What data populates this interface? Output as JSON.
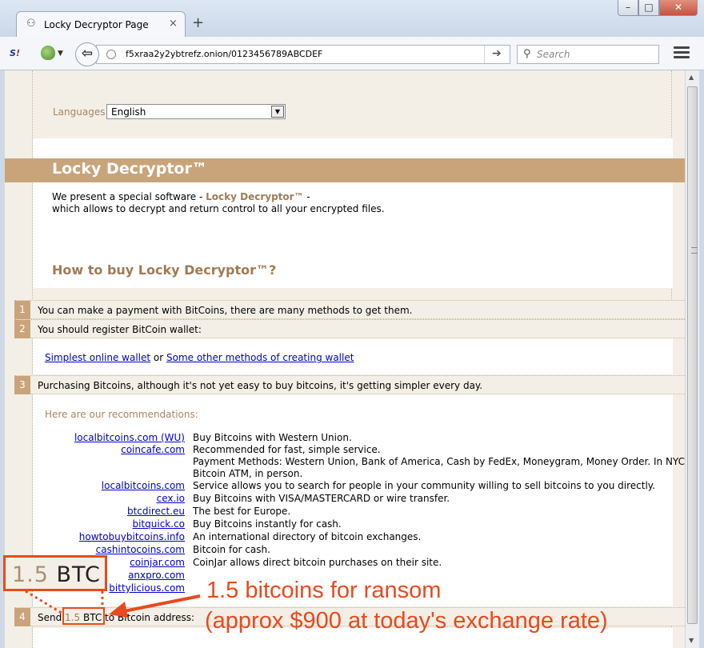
{
  "browser": {
    "tab_title": "Locky Decryptor Page",
    "tab_close": "×",
    "new_tab": "+",
    "url": "f5xraa2y2ybtrefz.onion/0123456789ABCDEF",
    "search_placeholder": "Search",
    "window_controls": {
      "minimize": "–",
      "maximize": "□",
      "close": "✕"
    }
  },
  "page": {
    "languages_label": "Languages:",
    "language_selected": "English",
    "title": "Locky Decryptor™",
    "intro_line1_prefix": "We present a special software - ",
    "intro_line1_brand": "Locky Decryptor™",
    "intro_line1_suffix": " -",
    "intro_line2": "which allows to decrypt and return control to all your encrypted files.",
    "howto_heading": "How to buy Locky Decryptor™?",
    "steps": [
      {
        "num": "1",
        "text": "You can make a payment with BitCoins, there are many methods to get them."
      },
      {
        "num": "2",
        "text": "You should register BitCoin wallet:"
      },
      {
        "num": "3",
        "text": "Purchasing Bitcoins, although it's not yet easy to buy bitcoins, it's getting simpler every day."
      },
      {
        "num": "4",
        "text_prefix": "Send ",
        "amount": "1.5",
        "unit": " BTC",
        "text_suffix": " to Bitcoin address:"
      }
    ],
    "wallet_links": {
      "simple": "Simplest online wallet",
      "or": " or ",
      "other": "Some other methods of creating wallet"
    },
    "recommendations_title": "Here are our recommendations:",
    "recommendations": [
      {
        "link": "localbitcoins.com (WU)",
        "desc": [
          "Buy Bitcoins with Western Union."
        ]
      },
      {
        "link": "coincafe.com",
        "desc": [
          "Recommended for fast, simple service.",
          "Payment Methods: Western Union, Bank of America, Cash by FedEx, Moneygram, Money Order. In NYC:",
          "Bitcoin ATM, in person."
        ]
      },
      {
        "link": "localbitcoins.com",
        "desc": [
          "Service allows you to search for people in your community willing to sell bitcoins to you directly."
        ]
      },
      {
        "link": "cex.io",
        "desc": [
          "Buy Bitcoins with VISA/MASTERCARD or wire transfer."
        ]
      },
      {
        "link": "btcdirect.eu",
        "desc": [
          "The best for Europe."
        ]
      },
      {
        "link": "bitquick.co",
        "desc": [
          "Buy Bitcoins instantly for cash."
        ]
      },
      {
        "link": "howtobuybitcoins.info",
        "desc": [
          "An international directory of bitcoin exchanges."
        ]
      },
      {
        "link": "cashintocoins.com",
        "desc": [
          "Bitcoin for cash."
        ]
      },
      {
        "link": "coinjar.com",
        "desc": [
          "CoinJar allows direct bitcoin purchases on their site."
        ]
      },
      {
        "link": "anxpro.com",
        "desc": []
      },
      {
        "link": "bittylicious.com",
        "desc": []
      }
    ]
  },
  "annotation": {
    "zoom_amount": "1.5",
    "zoom_unit": " BTC",
    "line1": "1.5 bitcoins for ransom",
    "line2": "(approx $900 at today's exchange rate)",
    "color": "#e84a1e"
  },
  "colors": {
    "accent_tan": "#c9a47b",
    "heading_brown": "#a07b55",
    "link_blue": "#0000cc"
  }
}
